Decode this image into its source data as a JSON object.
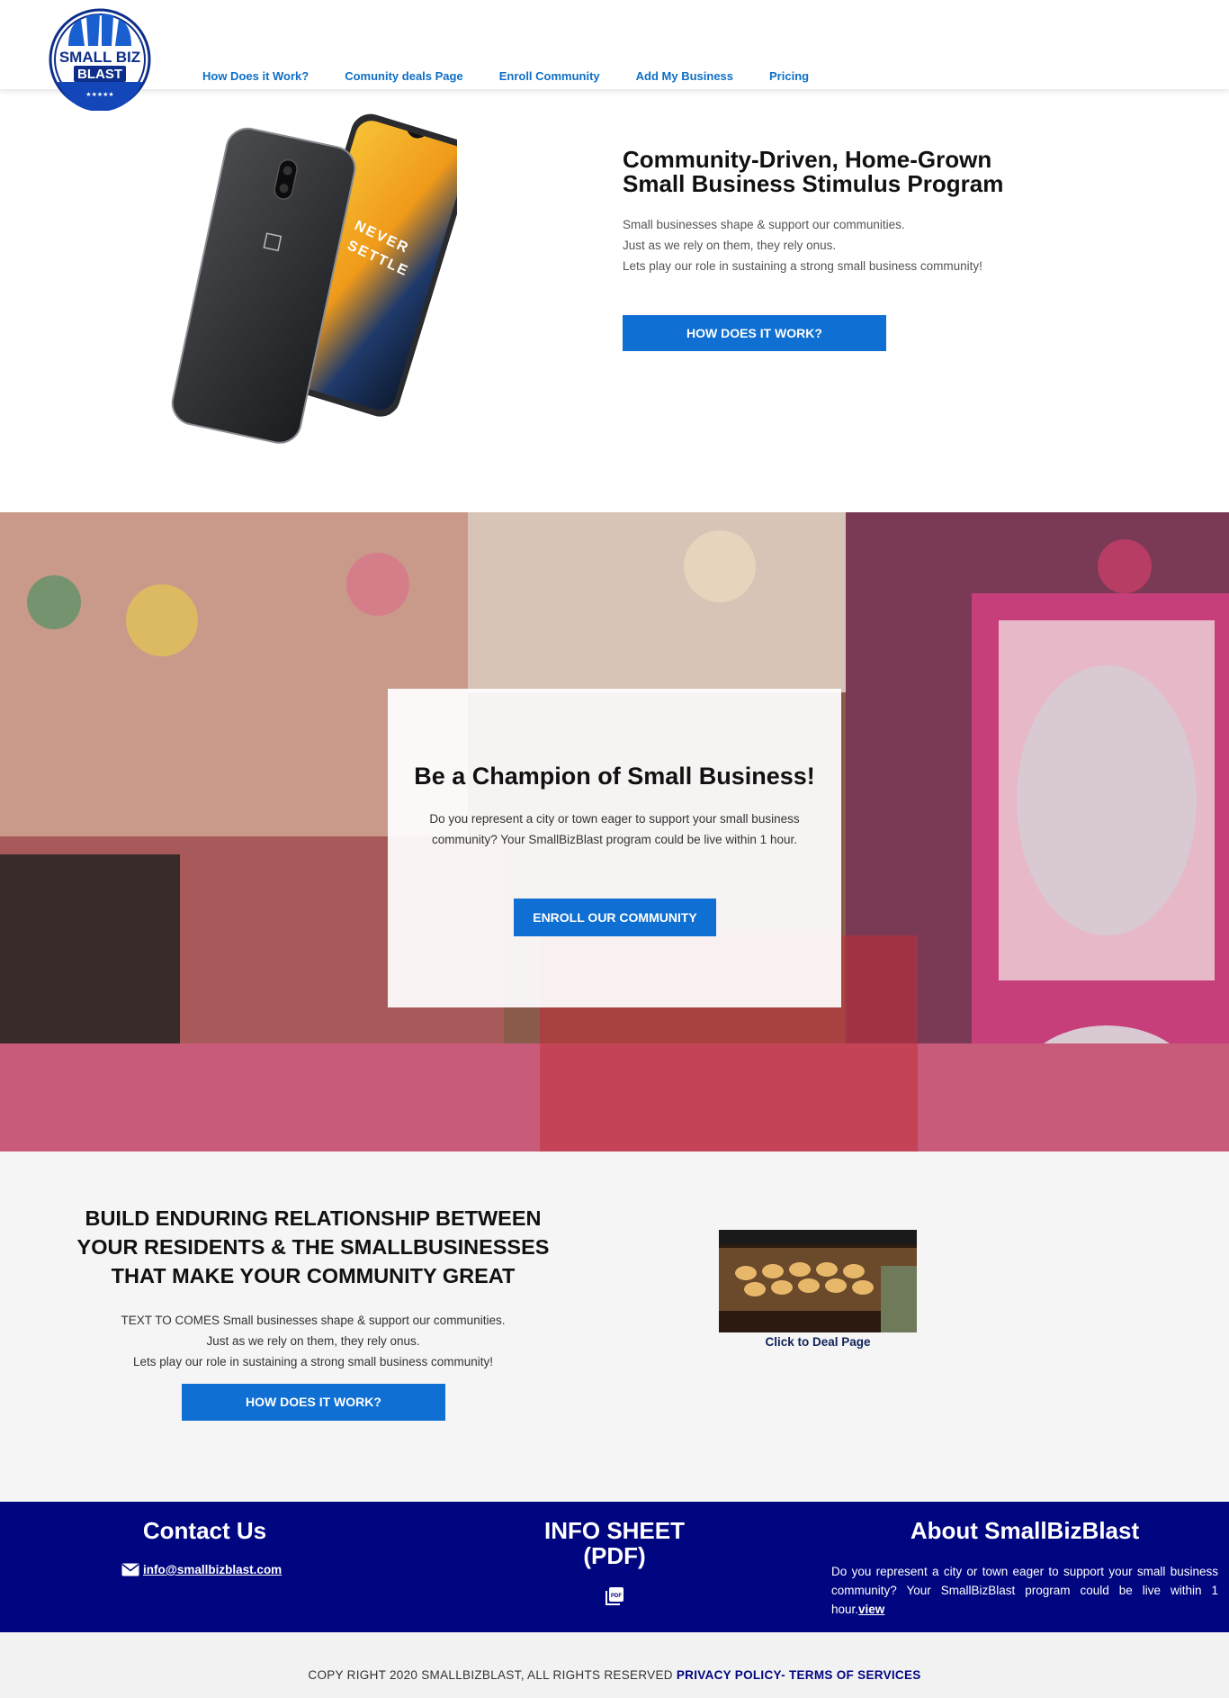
{
  "logo": {
    "line1": "SMALL BIZ",
    "line2": "BLAST"
  },
  "nav": {
    "items": [
      {
        "label": "How Does it Work?"
      },
      {
        "label": "Comunity deals Page"
      },
      {
        "label": "Enroll Community"
      },
      {
        "label": "Add My Business"
      },
      {
        "label": "Pricing"
      }
    ]
  },
  "hero": {
    "title_line1": "Community-Driven, Home-Grown",
    "title_line2": "Small Business Stimulus Program",
    "desc_line1": "Small businesses shape & support our communities.",
    "desc_line2": "Just as we rely on them, they rely onus.",
    "desc_line3": "Lets play our role in sustaining a strong small business community!",
    "button": "HOW DOES IT WORK?",
    "phone_screen_text1": "NEVER",
    "phone_screen_text2": "SETTLE"
  },
  "banner": {
    "title": "Be a Champion of Small Business!",
    "desc": "Do you represent a city or town eager to support your small business community? Your SmallBizBlast program could be live within 1 hour.",
    "button": "ENROLL OUR COMMUNITY"
  },
  "build": {
    "title_line1": "BUILD ENDURING RELATIONSHIP BETWEEN",
    "title_line2": "YOUR RESIDENTS & THE SMALLBUSINESSES",
    "title_line3": "THAT MAKE YOUR COMMUNITY GREAT",
    "desc_line1": "TEXT TO COMES Small businesses shape & support our communities.",
    "desc_line2": "Just as we rely on them, they rely onus.",
    "desc_line3": "Lets play our role in sustaining a strong small business community!",
    "button": "HOW DOES IT WORK?",
    "deal_caption": "Click to Deal Page"
  },
  "footer": {
    "contact_title": "Contact Us",
    "email": "info@smallbizblast.com",
    "info_title_line1": "INFO SHEET",
    "info_title_line2": "(PDF)",
    "about_title": "About SmallBizBlast",
    "about_text": "Do you represent a city or town eager to support your small business community? Your SmallBizBlast program could be live within 1 hour.",
    "about_link": "view"
  },
  "bottom": {
    "copyright": "COPY RIGHT 2020 SMALLBIZBLAST, ALL RIGHTS RESERVED ",
    "privacy": "PRIVACY POLICY",
    "separator": "- ",
    "terms": "TERMS OF SERVICES"
  },
  "colors": {
    "brand_blue": "#0f6fd2",
    "nav_blue": "#0f6fc6",
    "footer_navy": "#000680"
  }
}
